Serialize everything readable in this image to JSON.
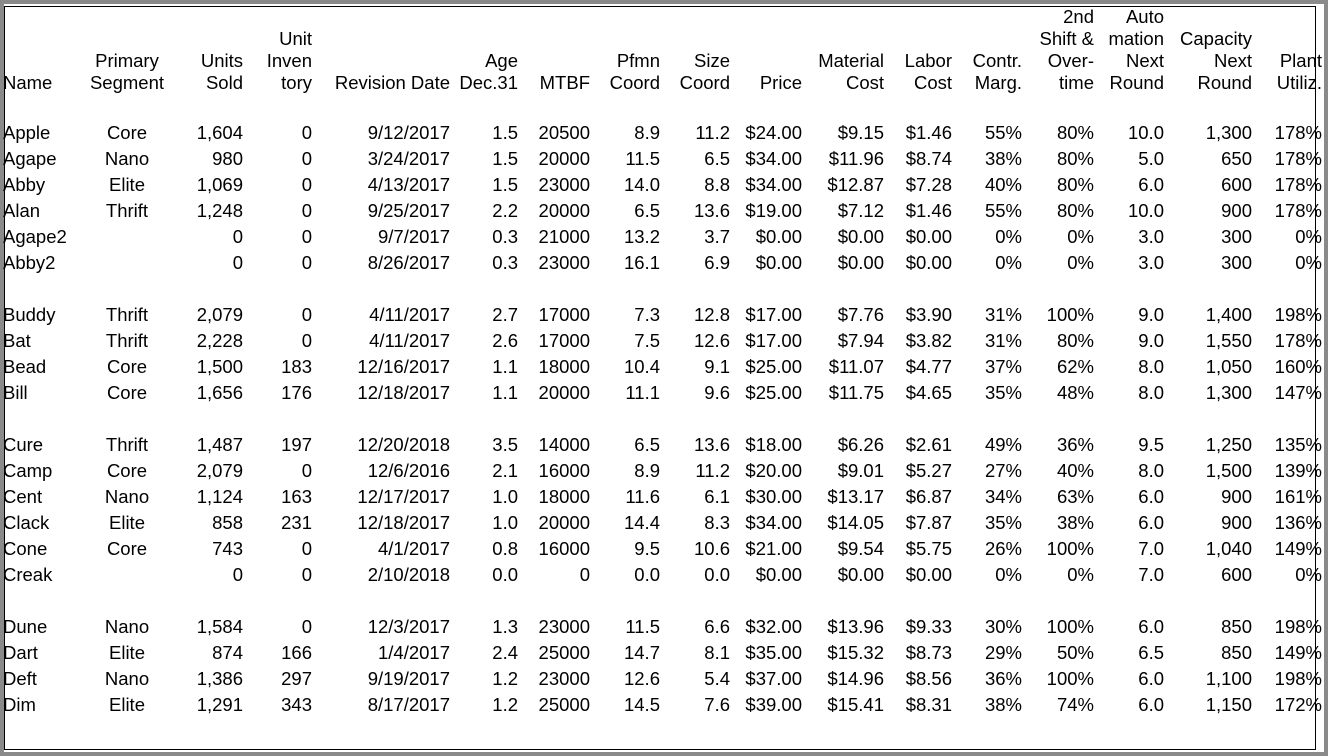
{
  "columns": [
    {
      "key": "name",
      "label": "Name"
    },
    {
      "key": "segment",
      "label": "Primary Segment"
    },
    {
      "key": "units_sold",
      "label": "Units Sold"
    },
    {
      "key": "inventory",
      "label": "Unit Inven tory"
    },
    {
      "key": "revision_date",
      "label": "Revision Date"
    },
    {
      "key": "age",
      "label": "Age Dec.31"
    },
    {
      "key": "mtbf",
      "label": "MTBF"
    },
    {
      "key": "pfmn",
      "label": "Pfmn Coord"
    },
    {
      "key": "size",
      "label": "Size Coord"
    },
    {
      "key": "price",
      "label": "Price"
    },
    {
      "key": "material",
      "label": "Material Cost"
    },
    {
      "key": "labor",
      "label": "Labor Cost"
    },
    {
      "key": "contr",
      "label": "Contr. Marg."
    },
    {
      "key": "overtime",
      "label": "2nd Shift & Over- time"
    },
    {
      "key": "automation",
      "label": "Auto mation Next Round"
    },
    {
      "key": "capacity",
      "label": "Capacity Next Round"
    },
    {
      "key": "plant",
      "label": "Plant Utiliz."
    }
  ],
  "header_lines": {
    "name": [
      "Name"
    ],
    "segment": [
      "Primary",
      "Segment"
    ],
    "units_sold": [
      "Units",
      "Sold"
    ],
    "inventory": [
      "Unit",
      "Inven",
      "tory"
    ],
    "revision_date": [
      "Revision Date"
    ],
    "age": [
      "Age",
      "Dec.31"
    ],
    "mtbf": [
      "MTBF"
    ],
    "pfmn": [
      "Pfmn",
      "Coord"
    ],
    "size": [
      "Size",
      "Coord"
    ],
    "price": [
      "Price"
    ],
    "material": [
      "Material",
      "Cost"
    ],
    "labor": [
      "Labor",
      "Cost"
    ],
    "contr": [
      "Contr.",
      "Marg."
    ],
    "overtime": [
      "2nd",
      "Shift &",
      "Over-",
      "time"
    ],
    "automation": [
      "Auto",
      "mation",
      "Next",
      "Round"
    ],
    "capacity": [
      "Capacity",
      "Next",
      "Round"
    ],
    "plant": [
      "Plant",
      "Utiliz."
    ]
  },
  "groups": [
    [
      [
        "Apple",
        "Core",
        "1,604",
        "0",
        "9/12/2017",
        "1.5",
        "20500",
        "8.9",
        "11.2",
        "$24.00",
        "$9.15",
        "$1.46",
        "55%",
        "80%",
        "10.0",
        "1,300",
        "178%"
      ],
      [
        "Agape",
        "Nano",
        "980",
        "0",
        "3/24/2017",
        "1.5",
        "20000",
        "11.5",
        "6.5",
        "$34.00",
        "$11.96",
        "$8.74",
        "38%",
        "80%",
        "5.0",
        "650",
        "178%"
      ],
      [
        "Abby",
        "Elite",
        "1,069",
        "0",
        "4/13/2017",
        "1.5",
        "23000",
        "14.0",
        "8.8",
        "$34.00",
        "$12.87",
        "$7.28",
        "40%",
        "80%",
        "6.0",
        "600",
        "178%"
      ],
      [
        "Alan",
        "Thrift",
        "1,248",
        "0",
        "9/25/2017",
        "2.2",
        "20000",
        "6.5",
        "13.6",
        "$19.00",
        "$7.12",
        "$1.46",
        "55%",
        "80%",
        "10.0",
        "900",
        "178%"
      ],
      [
        "Agape2",
        "",
        "0",
        "0",
        "9/7/2017",
        "0.3",
        "21000",
        "13.2",
        "3.7",
        "$0.00",
        "$0.00",
        "$0.00",
        "0%",
        "0%",
        "3.0",
        "300",
        "0%"
      ],
      [
        "Abby2",
        "",
        "0",
        "0",
        "8/26/2017",
        "0.3",
        "23000",
        "16.1",
        "6.9",
        "$0.00",
        "$0.00",
        "$0.00",
        "0%",
        "0%",
        "3.0",
        "300",
        "0%"
      ]
    ],
    [
      [
        "Buddy",
        "Thrift",
        "2,079",
        "0",
        "4/11/2017",
        "2.7",
        "17000",
        "7.3",
        "12.8",
        "$17.00",
        "$7.76",
        "$3.90",
        "31%",
        "100%",
        "9.0",
        "1,400",
        "198%"
      ],
      [
        "Bat",
        "Thrift",
        "2,228",
        "0",
        "4/11/2017",
        "2.6",
        "17000",
        "7.5",
        "12.6",
        "$17.00",
        "$7.94",
        "$3.82",
        "31%",
        "80%",
        "9.0",
        "1,550",
        "178%"
      ],
      [
        "Bead",
        "Core",
        "1,500",
        "183",
        "12/16/2017",
        "1.1",
        "18000",
        "10.4",
        "9.1",
        "$25.00",
        "$11.07",
        "$4.77",
        "37%",
        "62%",
        "8.0",
        "1,050",
        "160%"
      ],
      [
        "Bill",
        "Core",
        "1,656",
        "176",
        "12/18/2017",
        "1.1",
        "20000",
        "11.1",
        "9.6",
        "$25.00",
        "$11.75",
        "$4.65",
        "35%",
        "48%",
        "8.0",
        "1,300",
        "147%"
      ]
    ],
    [
      [
        "Cure",
        "Thrift",
        "1,487",
        "197",
        "12/20/2018",
        "3.5",
        "14000",
        "6.5",
        "13.6",
        "$18.00",
        "$6.26",
        "$2.61",
        "49%",
        "36%",
        "9.5",
        "1,250",
        "135%"
      ],
      [
        "Camp",
        "Core",
        "2,079",
        "0",
        "12/6/2016",
        "2.1",
        "16000",
        "8.9",
        "11.2",
        "$20.00",
        "$9.01",
        "$5.27",
        "27%",
        "40%",
        "8.0",
        "1,500",
        "139%"
      ],
      [
        "Cent",
        "Nano",
        "1,124",
        "163",
        "12/17/2017",
        "1.0",
        "18000",
        "11.6",
        "6.1",
        "$30.00",
        "$13.17",
        "$6.87",
        "34%",
        "63%",
        "6.0",
        "900",
        "161%"
      ],
      [
        "Clack",
        "Elite",
        "858",
        "231",
        "12/18/2017",
        "1.0",
        "20000",
        "14.4",
        "8.3",
        "$34.00",
        "$14.05",
        "$7.87",
        "35%",
        "38%",
        "6.0",
        "900",
        "136%"
      ],
      [
        "Cone",
        "Core",
        "743",
        "0",
        "4/1/2017",
        "0.8",
        "16000",
        "9.5",
        "10.6",
        "$21.00",
        "$9.54",
        "$5.75",
        "26%",
        "100%",
        "7.0",
        "1,040",
        "149%"
      ],
      [
        "Creak",
        "",
        "0",
        "0",
        "2/10/2018",
        "0.0",
        "0",
        "0.0",
        "0.0",
        "$0.00",
        "$0.00",
        "$0.00",
        "0%",
        "0%",
        "7.0",
        "600",
        "0%"
      ]
    ],
    [
      [
        "Dune",
        "Nano",
        "1,584",
        "0",
        "12/3/2017",
        "1.3",
        "23000",
        "11.5",
        "6.6",
        "$32.00",
        "$13.96",
        "$9.33",
        "30%",
        "100%",
        "6.0",
        "850",
        "198%"
      ],
      [
        "Dart",
        "Elite",
        "874",
        "166",
        "1/4/2017",
        "2.4",
        "25000",
        "14.7",
        "8.1",
        "$35.00",
        "$15.32",
        "$8.73",
        "29%",
        "50%",
        "6.5",
        "850",
        "149%"
      ],
      [
        "Deft",
        "Nano",
        "1,386",
        "297",
        "9/19/2017",
        "1.2",
        "23000",
        "12.6",
        "5.4",
        "$37.00",
        "$14.96",
        "$8.56",
        "36%",
        "100%",
        "6.0",
        "1,100",
        "198%"
      ],
      [
        "Dim",
        "Elite",
        "1,291",
        "343",
        "8/17/2017",
        "1.2",
        "25000",
        "14.5",
        "7.6",
        "$39.00",
        "$15.41",
        "$8.31",
        "38%",
        "74%",
        "6.0",
        "1,150",
        "172%"
      ]
    ]
  ]
}
